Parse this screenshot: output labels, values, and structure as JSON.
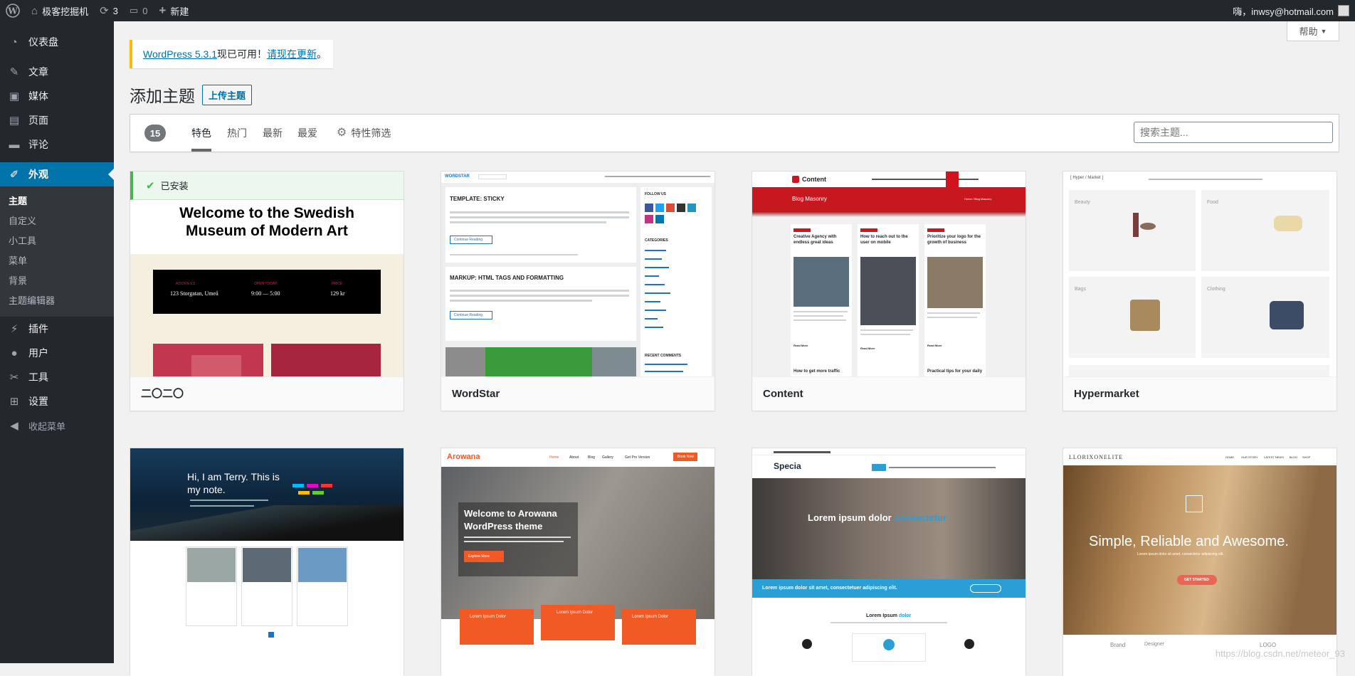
{
  "admin_bar": {
    "site_name": "极客挖掘机",
    "updates_count": "3",
    "comments_count": "0",
    "new_label": "新建",
    "greeting": "嗨，inwsy@hotmail.com"
  },
  "sidebar": {
    "items": [
      {
        "label": "仪表盘",
        "icon": "dashboard-icon"
      },
      {
        "label": "文章",
        "icon": "pin-icon"
      },
      {
        "label": "媒体",
        "icon": "media-icon"
      },
      {
        "label": "页面",
        "icon": "page-icon"
      },
      {
        "label": "评论",
        "icon": "comment-icon"
      },
      {
        "label": "外观",
        "icon": "brush-icon"
      },
      {
        "label": "插件",
        "icon": "plugin-icon"
      },
      {
        "label": "用户",
        "icon": "user-icon"
      },
      {
        "label": "工具",
        "icon": "wrench-icon"
      },
      {
        "label": "设置",
        "icon": "settings-icon"
      },
      {
        "label": "收起菜单",
        "icon": "collapse-icon"
      }
    ],
    "submenu": [
      "主题",
      "自定义",
      "小工具",
      "菜单",
      "背景",
      "主题编辑器"
    ]
  },
  "help_label": "帮助",
  "notice": {
    "link": "WordPress 5.3.1",
    "text": "现已可用！",
    "action": "请现在更新",
    "end": "。"
  },
  "page_title": "添加主题",
  "upload_label": "上传主题",
  "filter": {
    "count": "15",
    "tabs": [
      "特色",
      "热门",
      "最新",
      "最爱"
    ],
    "feature_filter": "特性筛选",
    "search_placeholder": "搜索主题..."
  },
  "themes": [
    {
      "name": "二〇二〇",
      "installed_label": "已安装"
    },
    {
      "name": "WordStar"
    },
    {
      "name": "Content"
    },
    {
      "name": "Hypermarket"
    },
    {
      "name": ""
    },
    {
      "name": ""
    },
    {
      "name": ""
    },
    {
      "name": ""
    }
  ],
  "previews": {
    "twenty": {
      "title": "Welcome to the Swedish Museum of Modern Art",
      "col1_h": "ADDRESS",
      "col1": "123 Storgatan, Umeå",
      "col2_h": "OPEN TODAY",
      "col2": "9:00 — 5:00",
      "col3_h": "PRICE",
      "col3": "129 kr"
    },
    "wordstar": {
      "logo": "WORDSTAR",
      "post1": "TEMPLATE: STICKY",
      "post2": "MARKUP: HTML TAGS AND FORMATTING",
      "follow": "FOLLOW US",
      "categories": "CATEGORIES",
      "recent": "RECENT COMMENTS",
      "read_more": "Continue Reading"
    },
    "content": {
      "logo": "Content",
      "banner": "Blog Masonry",
      "crumb": "Home / Blog Masonry",
      "card1": "Creative Agency with endless great ideas",
      "card2": "How to reach out to the user on mobile",
      "card3": "Prioritize your logo for the growth of business",
      "card4": "How to get more traffic",
      "card5": "Practical tips for your daily",
      "read_more": "Read More"
    },
    "hypermarket": {
      "logo": "[ Hyper / Market ]",
      "c1": "Beauty",
      "c2": "Food",
      "c3": "Bags",
      "c4": "Clothing"
    },
    "terry": {
      "title1": "Hi, I am Terry. This is",
      "title2": "my note."
    },
    "arowana": {
      "logo": "Arowana",
      "title1": "Welcome to Arowana",
      "title2": "WordPress theme",
      "button": "Explore More",
      "nav": [
        "Home",
        "About",
        "Blog",
        "Gallery",
        "Get Pro Version"
      ],
      "book": "Book Now",
      "box": "Lorem Ipsum Dolor"
    },
    "specia": {
      "logo": "Specia",
      "hero1": "Lorem ipsum dolor",
      "hero2": "consectetur",
      "strip": "Lorem ipsum dolor sit amet, consectetuer adipiscing elit.",
      "section1": "Lorem Ipsum",
      "section2": "dolor"
    },
    "llorix": {
      "logo": "LLORIXONELITE",
      "nav": [
        "HOME",
        "OUR STORY",
        "LATEST NEWS",
        "BLOG",
        "SHOP"
      ],
      "hero": "Simple, Reliable and Awesome.",
      "sub": "Lorem ipsum dolor sit amet, consectetur adipiscing elit.",
      "button": "GET STARTED",
      "brands": [
        "Brand",
        "Designer",
        "LOGO"
      ]
    }
  },
  "watermark": "https://blog.csdn.net/meteor_93"
}
